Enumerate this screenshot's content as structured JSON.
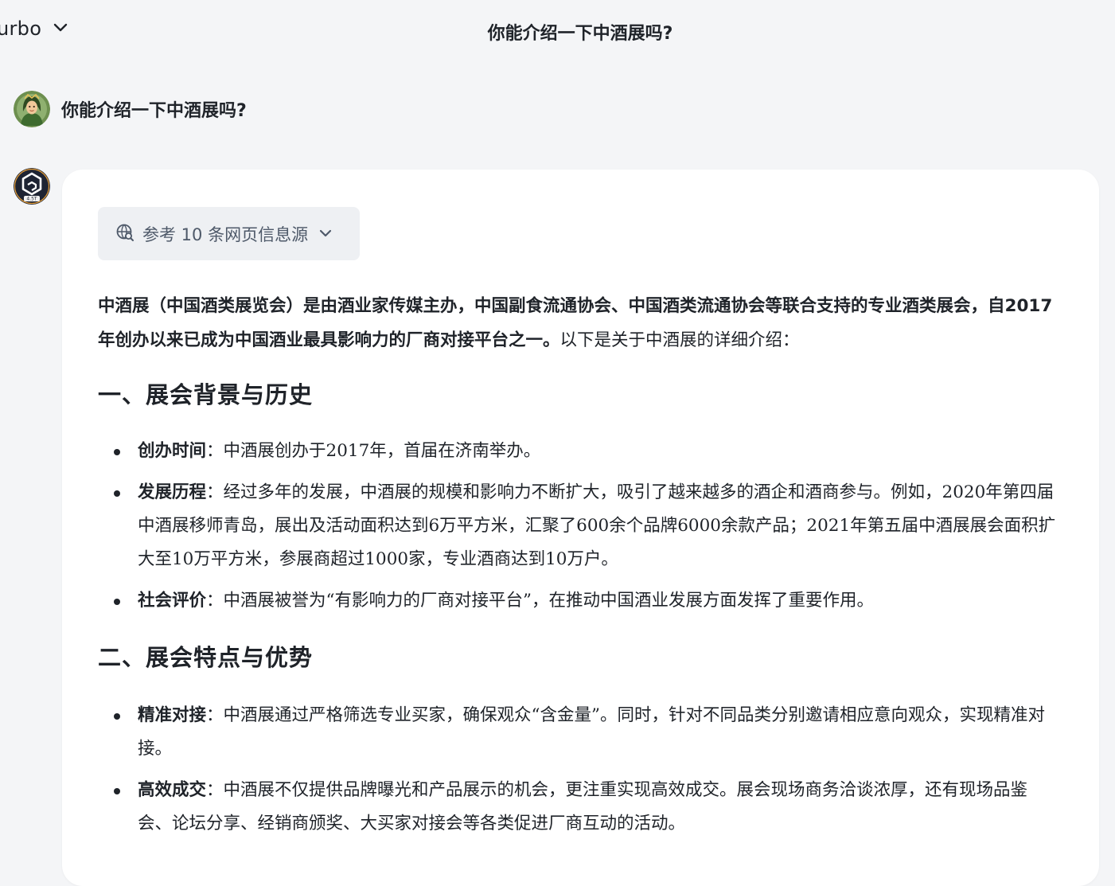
{
  "header": {
    "model_name": "urbo",
    "title": "你能介绍一下中酒展吗?"
  },
  "user_message": {
    "text": "你能介绍一下中酒展吗?"
  },
  "assistant": {
    "avatar_badge": "4.5T",
    "sources_label": "参考 10 条网页信息源",
    "intro_bold": "中酒展（中国酒类展览会）是由酒业家传媒主办，中国副食流通协会、中国酒类流通协会等联合支持的专业酒类展会，自2017年创办以来已成为中国酒业最具影响力的厂商对接平台之一。",
    "intro_rest": "以下是关于中酒展的详细介绍：",
    "sections": [
      {
        "heading": "一、展会背景与历史",
        "items": [
          {
            "label": "创办时间",
            "sep": "：",
            "text": "中酒展创办于2017年，首届在济南举办。"
          },
          {
            "label": "发展历程",
            "sep": "：",
            "text": "经过多年的发展，中酒展的规模和影响力不断扩大，吸引了越来越多的酒企和酒商参与。例如，2020年第四届中酒展移师青岛，展出及活动面积达到6万平方米，汇聚了600余个品牌6000余款产品；2021年第五届中酒展展会面积扩大至10万平方米，参展商超过1000家，专业酒商达到10万户。"
          },
          {
            "label": "社会评价",
            "sep": "：",
            "text": "中酒展被誉为“有影响力的厂商对接平台”，在推动中国酒业发展方面发挥了重要作用。"
          }
        ]
      },
      {
        "heading": "二、展会特点与优势",
        "items": [
          {
            "label": "精准对接",
            "sep": "：",
            "text": "中酒展通过严格筛选专业买家，确保观众“含金量”。同时，针对不同品类分别邀请相应意向观众，实现精准对接。"
          },
          {
            "label": "高效成交",
            "sep": "：",
            "text": "中酒展不仅提供品牌曝光和产品展示的机会，更注重实现高效成交。展会现场商务洽谈浓厚，还有现场品鉴会、论坛分享、经销商颁奖、大买家对接会等各类促进厂商互动的活动。"
          }
        ]
      }
    ]
  },
  "colors": {
    "page_bg": "#f4f5f7",
    "card_bg": "#ffffff",
    "chip_bg": "#eef0f3",
    "text": "#1f2329",
    "muted": "#4e5969"
  }
}
